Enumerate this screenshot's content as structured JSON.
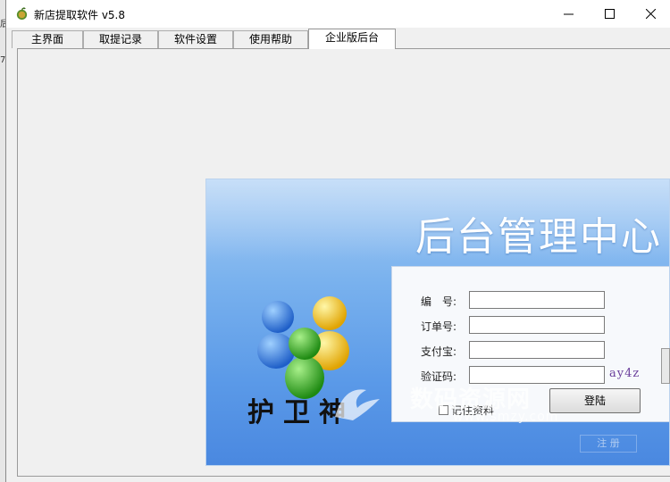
{
  "window": {
    "title": "新店提取软件 v5.8",
    "controls": {
      "minimize": "minimize",
      "maximize": "maximize",
      "close": "close"
    }
  },
  "tabs": [
    {
      "label": "主界面"
    },
    {
      "label": "取提记录"
    },
    {
      "label": "软件设置"
    },
    {
      "label": "使用帮助"
    },
    {
      "label": "企业版后台",
      "active": true
    }
  ],
  "login_panel": {
    "title": "后台管理中心",
    "fields": [
      {
        "label": "编　号:",
        "value": ""
      },
      {
        "label": "订单号:",
        "value": ""
      },
      {
        "label": "支付宝:",
        "value": ""
      },
      {
        "label": "验证码:",
        "value": ""
      }
    ],
    "captcha": "ay4z",
    "remember_label": "记住资料",
    "login_button": "登陆",
    "secondary_button": "注 册",
    "brand_text": "护卫神"
  },
  "watermark": {
    "text": "数码资源网",
    "url": "www.smzy.com"
  },
  "colors": {
    "panel_blue": "#5b9ae8",
    "panel_light": "#a9cdf4",
    "captcha": "#6a3e9b"
  }
}
